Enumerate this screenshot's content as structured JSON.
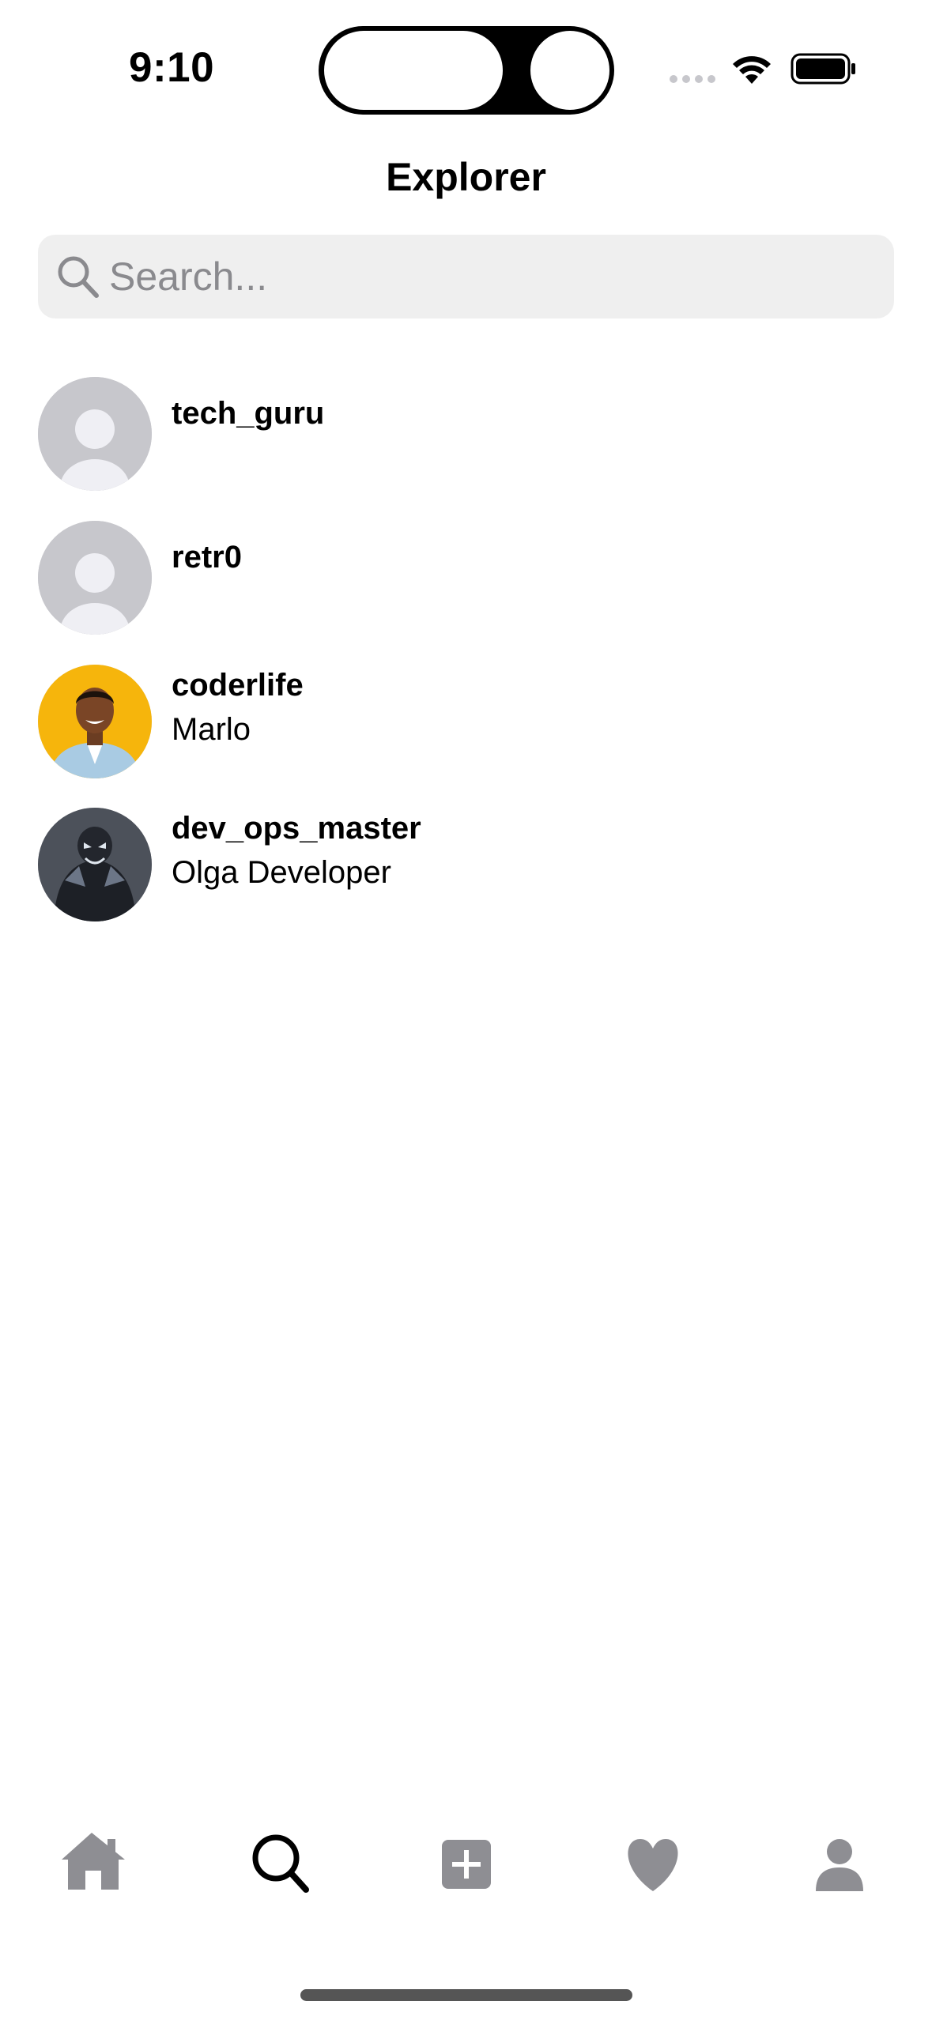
{
  "status_bar": {
    "time": "9:10"
  },
  "header": {
    "title": "Explorer"
  },
  "search": {
    "placeholder": "Search...",
    "value": ""
  },
  "users": [
    {
      "username": "tech_guru",
      "full_name": "",
      "avatar": "placeholder"
    },
    {
      "username": "retr0",
      "full_name": "",
      "avatar": "placeholder"
    },
    {
      "username": "coderlife",
      "full_name": "Marlo",
      "avatar": "photo-smiling-man-yellow-background"
    },
    {
      "username": "dev_ops_master",
      "full_name": "Olga Developer",
      "avatar": "photo-dark-armored-figure"
    }
  ],
  "tab_bar": {
    "tabs": [
      {
        "icon": "home-icon",
        "active": false
      },
      {
        "icon": "search-icon",
        "active": true
      },
      {
        "icon": "add-post-icon",
        "active": false
      },
      {
        "icon": "heart-icon",
        "active": false
      },
      {
        "icon": "profile-icon",
        "active": false
      }
    ],
    "active_color": "#000000",
    "inactive_color": "#8e8e93"
  },
  "colors": {
    "search_background": "#efefef",
    "placeholder_avatar": "#c7c7cc",
    "text_primary": "#000000",
    "placeholder_text": "#8a8a8e"
  }
}
